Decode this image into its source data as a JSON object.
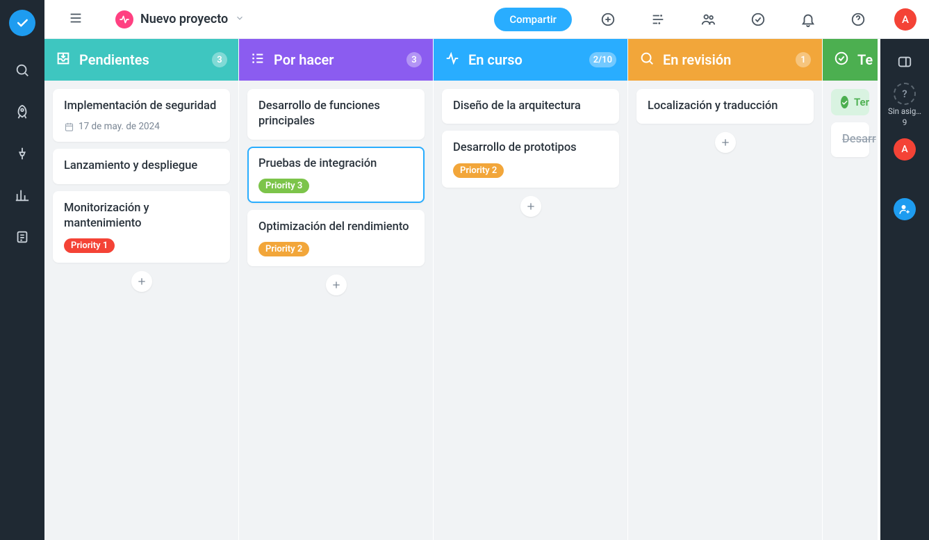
{
  "project": {
    "name": "Nuevo proyecto"
  },
  "header": {
    "share_label": "Compartir",
    "avatar_initial": "A"
  },
  "columns": [
    {
      "id": "backlog",
      "title": "Pendientes",
      "badge": "3",
      "color": "#3ec6c0",
      "icon": "inbox-icon",
      "cards": [
        {
          "title": "Implementación de seguridad",
          "date": "17 de may. de 2024"
        },
        {
          "title": "Lanzamiento y despliegue"
        },
        {
          "title": "Monitorización y mantenimiento",
          "tag": {
            "label": "Priority 1",
            "color": "#f44336"
          }
        }
      ]
    },
    {
      "id": "todo",
      "title": "Por hacer",
      "badge": "3",
      "color": "#8b5cf0",
      "icon": "list-icon",
      "cards": [
        {
          "title": "Desarrollo de funciones principales"
        },
        {
          "title": "Pruebas de integración",
          "tag": {
            "label": "Priority 3",
            "color": "#7cc44a"
          },
          "selected": true
        },
        {
          "title": "Optimización del rendimiento",
          "tag": {
            "label": "Priority 2",
            "color": "#f2a63a"
          }
        }
      ]
    },
    {
      "id": "inprogress",
      "title": "En curso",
      "badge": "2/10",
      "color": "#29adff",
      "icon": "activity-icon",
      "cards": [
        {
          "title": "Diseño de la arquitectura"
        },
        {
          "title": "Desarrollo de prototipos",
          "tag": {
            "label": "Priority 2",
            "color": "#f2a63a"
          }
        }
      ]
    },
    {
      "id": "review",
      "title": "En revisión",
      "badge": "1",
      "color": "#f2a63a",
      "icon": "search-icon",
      "cards": [
        {
          "title": "Localización y traducción"
        }
      ]
    },
    {
      "id": "done",
      "title": "Te",
      "color": "#4caf50",
      "icon": "check-circle-icon",
      "done_chip": "Ter",
      "cards": [
        {
          "title": "Desarr",
          "done": true
        }
      ]
    }
  ],
  "rightbar": {
    "unassigned_label": "Sin asig…",
    "unassigned_count": "9",
    "avatar_initial": "A",
    "unassigned_symbol": "?"
  }
}
